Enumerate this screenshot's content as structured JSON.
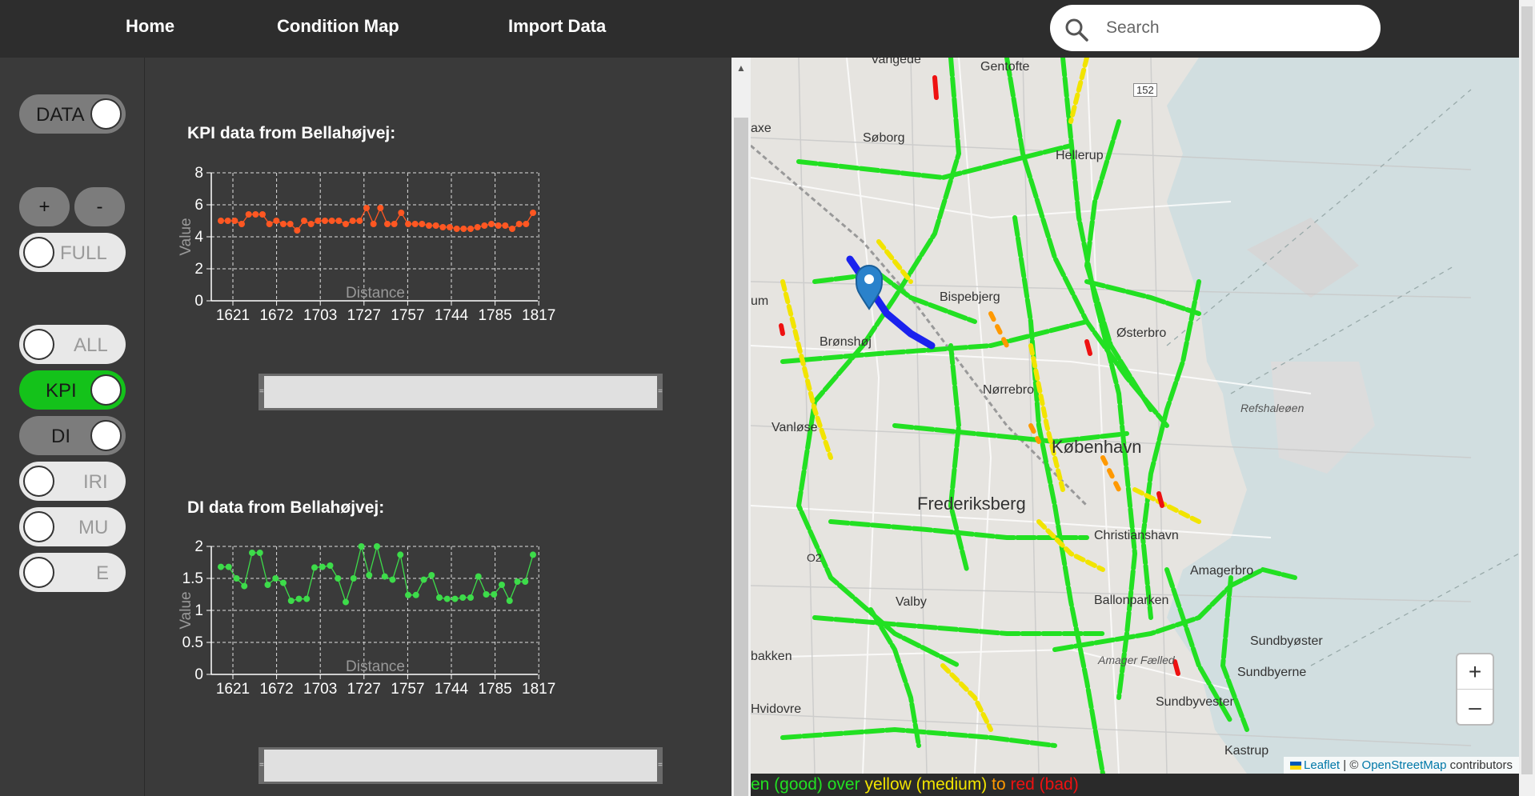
{
  "nav": {
    "home": "Home",
    "condition_map": "Condition Map",
    "import_data": "Import Data",
    "search_placeholder": "Search"
  },
  "sidebar": {
    "data_toggle": "DATA",
    "zoom_in": "+",
    "zoom_out": "-",
    "full_toggle": "FULL",
    "layers": [
      {
        "label": "ALL",
        "state": "off"
      },
      {
        "label": "KPI",
        "state": "on-green"
      },
      {
        "label": "DI",
        "state": "on-gray"
      },
      {
        "label": "IRI",
        "state": "off"
      },
      {
        "label": "MU",
        "state": "off"
      },
      {
        "label": "E",
        "state": "off"
      }
    ]
  },
  "charts": {
    "kpi_title": "KPI data from Bellahøjvej:",
    "di_title": "DI data from Bellahøjvej:"
  },
  "chart_data": [
    {
      "type": "line",
      "title": "KPI data from Bellahøjvej:",
      "xlabel": "Distance",
      "ylabel": "Value",
      "color": "#ff5722",
      "ylim": [
        0,
        8
      ],
      "yticks": [
        "0",
        "2",
        "4",
        "6",
        "8"
      ],
      "xticks": [
        "1621",
        "1672",
        "1703",
        "1727",
        "1757",
        "1744",
        "1785",
        "1817"
      ],
      "values": [
        5.0,
        5.0,
        5.0,
        4.8,
        5.4,
        5.4,
        5.4,
        4.8,
        5.0,
        4.8,
        4.8,
        4.4,
        5.0,
        4.8,
        5.0,
        5.0,
        5.0,
        5.0,
        4.8,
        5.0,
        5.0,
        5.8,
        4.8,
        5.8,
        4.8,
        4.8,
        5.5,
        4.8,
        4.8,
        4.8,
        4.7,
        4.7,
        4.6,
        4.6,
        4.5,
        4.5,
        4.5,
        4.6,
        4.7,
        4.8,
        4.7,
        4.7,
        4.5,
        4.8,
        4.8,
        5.5
      ]
    },
    {
      "type": "line",
      "title": "DI data from Bellahøjvej:",
      "xlabel": "Distance",
      "ylabel": "Value",
      "color": "#3ddc4a",
      "ylim": [
        0,
        2
      ],
      "yticks": [
        "0",
        "0.5",
        "1",
        "1.5",
        "2"
      ],
      "xticks": [
        "1621",
        "1672",
        "1703",
        "1727",
        "1757",
        "1744",
        "1785",
        "1817"
      ],
      "values": [
        1.68,
        1.68,
        1.5,
        1.38,
        1.9,
        1.9,
        1.4,
        1.5,
        1.43,
        1.15,
        1.18,
        1.18,
        1.67,
        1.68,
        1.7,
        1.5,
        1.13,
        1.5,
        2.0,
        1.55,
        2.0,
        1.53,
        1.48,
        1.87,
        1.24,
        1.24,
        1.48,
        1.55,
        1.2,
        1.18,
        1.18,
        1.2,
        1.2,
        1.53,
        1.25,
        1.25,
        1.4,
        1.15,
        1.45,
        1.45,
        1.87
      ]
    }
  ],
  "map": {
    "labels": [
      "Gentofte",
      "Søborg",
      "Hellerup",
      "Bispebjerg",
      "Brønshøj",
      "Østerbro",
      "Nørrebro",
      "Vanløse",
      "København",
      "Frederiksberg",
      "Christianshavn",
      "Valby",
      "Amagerbro",
      "Ballonparken",
      "Sundbyøster",
      "Sundbyerne",
      "Sundbyvester",
      "Hvidovre",
      "Kastrup",
      "Refshaleøen",
      "Amager Fælled",
      "152",
      "Vangede",
      "axe",
      "um",
      "bakken",
      "O2"
    ],
    "attribution_leaflet": "Leaflet",
    "attribution_sep": " | © ",
    "attribution_osm": "OpenStreetMap",
    "attribution_tail": " contributors",
    "zoom_in": "+",
    "zoom_out": "–"
  },
  "legend": {
    "green_part": "en (good)",
    "over": " over ",
    "yellow_part": "yellow (medium)",
    "to": " to ",
    "red_part": "red (bad)"
  }
}
